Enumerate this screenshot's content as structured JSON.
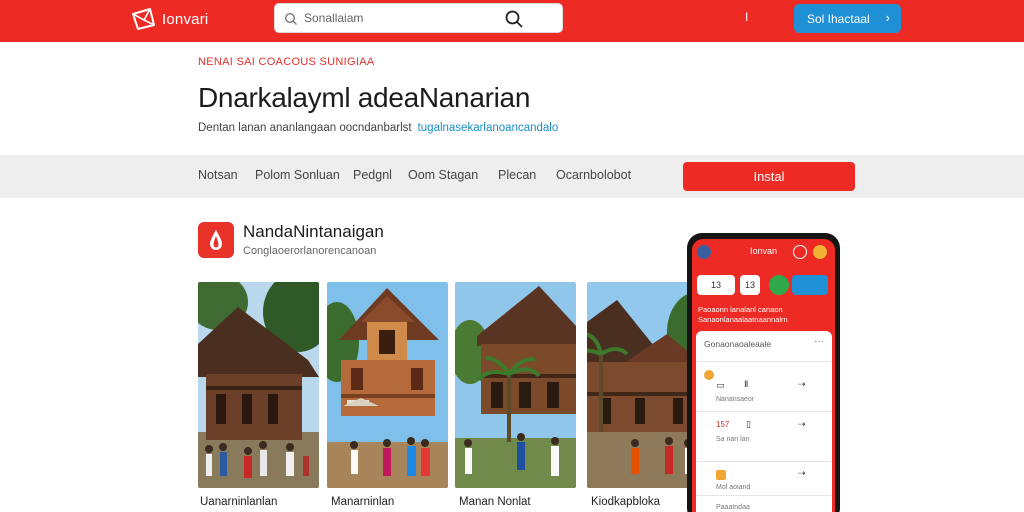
{
  "header": {
    "logo_text": "Ionvari",
    "search_placeholder": "Sonallaiam",
    "dot_menu": "I",
    "install_label": "Sol Ihactaal",
    "install_chevron": "›"
  },
  "hero": {
    "kicker": "NENAI SAI COACOUS SUNIGIAA",
    "title": "Dnarkalayml adeaNanarian",
    "subtitle": "Dentan lanan ananlangaan oocndanbarlst",
    "link": "tugalnasekarlanoancandalo"
  },
  "nav": {
    "items": [
      "Notsan",
      "Polom Sonluan",
      "Pedgnl",
      "Oom Stagan",
      "Plecan",
      "Ocarnbolobot"
    ],
    "install_label": "Instal"
  },
  "app": {
    "name": "NandaNintanaigan",
    "developer": "Conglaoerorlanorencanoan"
  },
  "gallery": {
    "captions": [
      "Uanarninlanlan",
      "Manarninlan",
      "Manan Nonlat",
      "Kiodkapbloka"
    ]
  },
  "phone": {
    "title": "Ionvan",
    "chips": [
      "13",
      "13"
    ],
    "promo_line1": "Paoaonn lanalanl canaon",
    "promo_line2": "Sanaonlanaalaatnaannalrn",
    "card_title": "Gonaonaoaleaale",
    "card_dots": "···",
    "row_labels": [
      "Nanansaeor",
      "Sa nan lan",
      "Mol aoiand",
      "Paaatndaa"
    ],
    "row_tag": "157"
  },
  "colors": {
    "brand_red": "#ee2a24",
    "install_blue": "#1f8fd6",
    "link_blue": "#1a8fc9",
    "nav_band": "#eeeeee"
  }
}
